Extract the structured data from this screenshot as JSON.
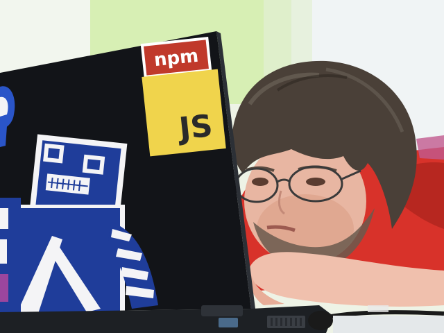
{
  "photo": {
    "colors": {
      "wall_left": "#e9f1dc",
      "wall_green": "#d6efb0",
      "wall_right": "#eef4f6",
      "laptop_lid": "#121418",
      "laptop_base": "#1d2024",
      "hair": "#4a4038",
      "skin": "#e8b6a2",
      "shirt": "#d8322a",
      "robot_blue": "#1f3d9a",
      "sticker_npm_red": "#c0392b",
      "sticker_js_yellow": "#f0d44c"
    },
    "stickers": {
      "npm": {
        "text": "npm"
      },
      "js": {
        "text": "JS"
      }
    }
  }
}
